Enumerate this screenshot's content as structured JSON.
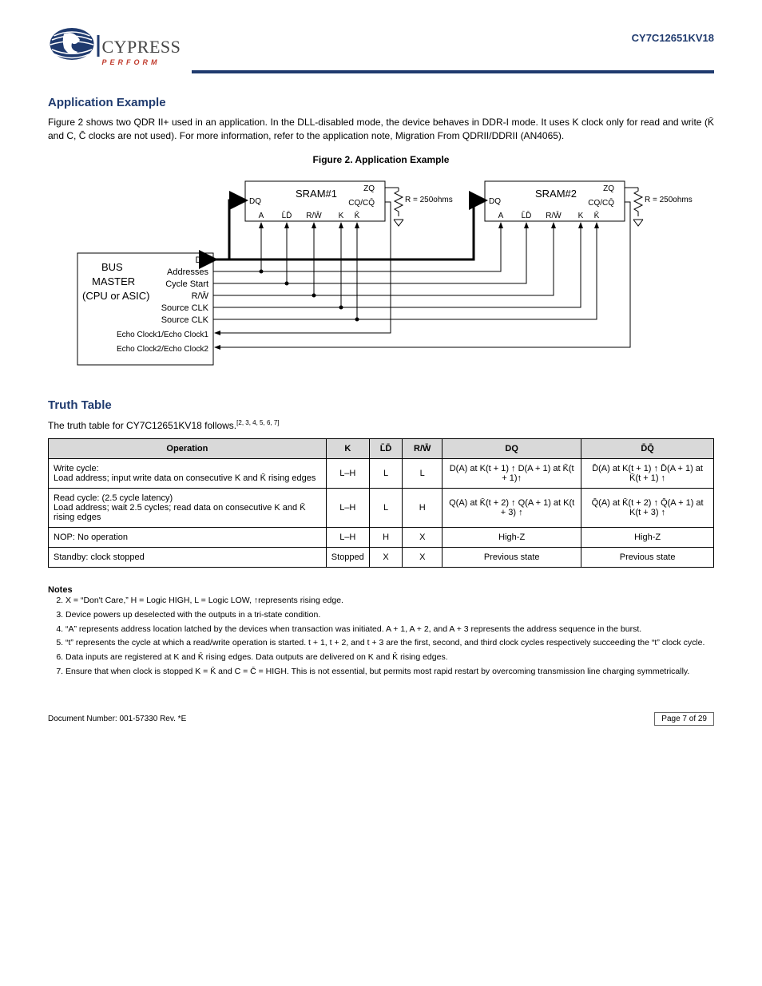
{
  "header": {
    "doc_code": "CY7C12651KV18",
    "logo_top": "CYPRESS",
    "logo_bottom": "P E R F O R M"
  },
  "section1": {
    "title": "Application Example",
    "fig_caption": "Figure 2.  Application Example",
    "body": "Figure 2 shows two QDR II+ used in an application. In the DLL-disabled mode, the device behaves in DDR-I mode. It uses K clock only for read and write (K̄ and C, C̄ clocks are not used). For more information, refer to the application note, Migration From QDRII/DDRII (AN4065).",
    "diagram": {
      "busmaster": {
        "title_line1": "BUS",
        "title_line2": "MASTER",
        "title_line3": "(CPU or ASIC)",
        "signals": [
          "DQ",
          "Addresses",
          "Cycle Start",
          "R/W̄",
          "Source CLK",
          "Source CLK",
          "Echo Clock1/Echo Clock1",
          "Echo Clock2/Echo Clock2"
        ]
      },
      "sram1": {
        "title": "SRAM#1",
        "pins_left": "DQ",
        "pins_bottom": [
          "A",
          "L̄D̄",
          "R/W̄",
          "K",
          "K̄"
        ],
        "pins_right_top": "ZQ",
        "pins_right_bottom": "CQ/CQ̄",
        "resistor": "R = 250ohms"
      },
      "sram2": {
        "title": "SRAM#2",
        "pins_left": "DQ",
        "pins_bottom": [
          "A",
          "L̄D̄",
          "R/W̄",
          "K",
          "K̄"
        ],
        "pins_right_top": "ZQ",
        "pins_right_bottom": "CQ/CQ̄",
        "resistor": "R = 250ohms"
      }
    }
  },
  "section2": {
    "title": "Truth Table",
    "intro": "The truth table for CY7C12651KV18 follows.",
    "noteref": "[2, 3, 4, 5, 6, 7]",
    "headers": {
      "operation": "Operation",
      "k": "K",
      "ld": "L̄D̄",
      "rw": "R/W̄",
      "dq": "DQ",
      "dqbar": "D̄Q̄"
    },
    "rows": [
      {
        "op_l1": "Write cycle:",
        "op_l2": "Load address; input write data on consecutive K and K̄ rising edges",
        "k": "L–H",
        "ld": "L",
        "rw": "L",
        "dq": "D(A) at K(t + 1) ↑ D(A + 1) at K̄(t + 1)↑",
        "dqbar": "D̄(A) at K(t + 1) ↑ D̄(A + 1) at K̄(t + 1) ↑"
      },
      {
        "op_l1": "Read cycle: (2.5 cycle latency)",
        "op_l2": "Load address; wait 2.5 cycles; read data on consecutive K and K̄ rising edges",
        "k": "L–H",
        "ld": "L",
        "rw": "H",
        "dq": "Q(A) at K̄(t + 2) ↑ Q(A + 1) at K(t + 3) ↑",
        "dqbar": "Q̄(A) at K̄(t + 2) ↑ Q̄(A + 1) at K(t + 3) ↑"
      },
      {
        "op_l1": "NOP: No operation",
        "op_l2": "",
        "k": "L–H",
        "ld": "H",
        "rw": "X",
        "dq": "High-Z",
        "dqbar": "High-Z"
      },
      {
        "op_l1": "Standby: clock stopped",
        "op_l2": "",
        "k": "Stopped",
        "ld": "X",
        "rw": "X",
        "dq": "Previous state",
        "dqbar": "Previous state"
      }
    ]
  },
  "notes": {
    "heading": "Notes",
    "start": 2,
    "items": [
      "X = “Don't Care,” H = Logic HIGH, L = Logic LOW, ↑represents rising edge.",
      "Device powers up deselected with the outputs in a tri-state condition.",
      "“A” represents address location latched by the devices when transaction was initiated. A + 1, A + 2, and A + 3 represents the address sequence in the burst.",
      "“t” represents the cycle at which a read/write operation is started. t + 1, t + 2, and t + 3 are the first, second, and third clock cycles respectively succeeding the “t” clock cycle.",
      "Data inputs are registered at K and K̄ rising edges. Data outputs are delivered on K and K̄ rising edges.",
      "Ensure that when clock is stopped K = K̄ and C = C̄ = HIGH. This is not essential, but permits most rapid restart by overcoming transmission line charging symmetrically."
    ]
  },
  "footer": {
    "doc_no": "Document Number: 001-57330 Rev. *E",
    "page": "Page 7 of 29"
  }
}
